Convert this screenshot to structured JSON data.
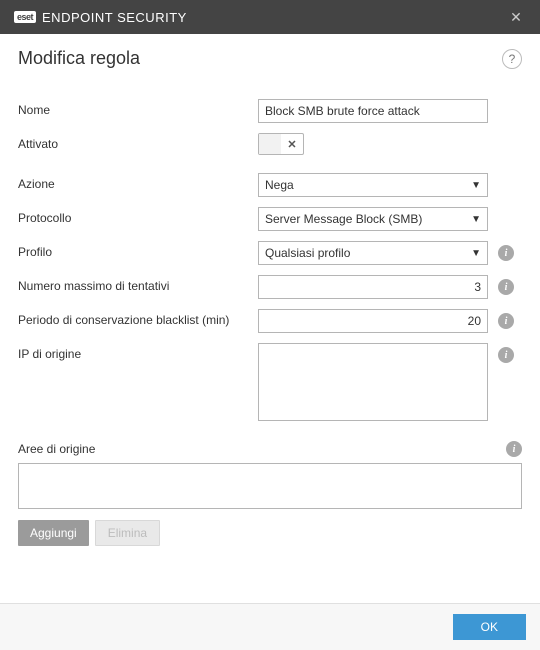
{
  "titlebar": {
    "brand_badge": "eset",
    "brand_light": "ENDPOINT ",
    "brand_bold": "SECURITY"
  },
  "header": {
    "title": "Modifica regola"
  },
  "form": {
    "name_label": "Nome",
    "name_value": "Block SMB brute force attack",
    "enabled_label": "Attivato",
    "enabled_state": "off",
    "enabled_mark": "✕",
    "action_label": "Azione",
    "action_value": "Nega",
    "protocol_label": "Protocollo",
    "protocol_value": "Server Message Block (SMB)",
    "profile_label": "Profilo",
    "profile_value": "Qualsiasi profilo",
    "max_attempts_label": "Numero massimo di tentativi",
    "max_attempts_value": "3",
    "blacklist_period_label": "Periodo di conservazione blacklist (min)",
    "blacklist_period_value": "20",
    "source_ip_label": "IP di origine",
    "source_ip_value": "",
    "source_zones_label": "Aree di origine",
    "source_zones_value": "",
    "add_button": "Aggiungi",
    "delete_button": "Elimina"
  },
  "footer": {
    "ok": "OK"
  }
}
